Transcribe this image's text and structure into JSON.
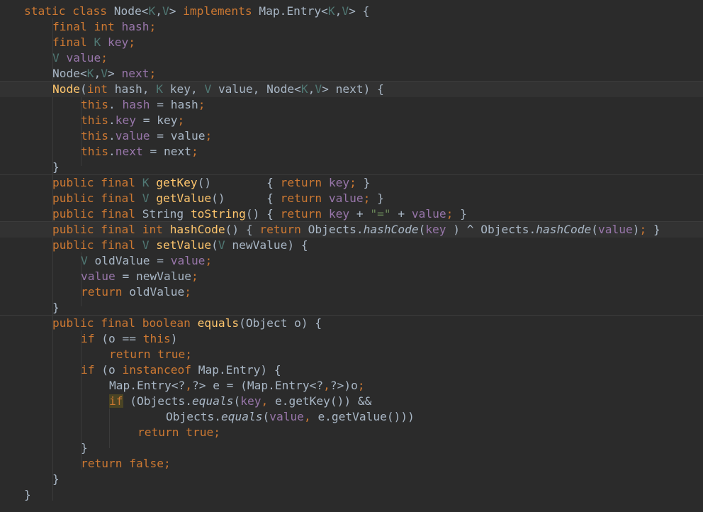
{
  "editor": {
    "language": "Java",
    "lines": [
      [
        [
          "kw",
          "static class "
        ],
        [
          "",
          "Node<"
        ],
        [
          "tp",
          "K"
        ],
        [
          "",
          ","
        ],
        [
          "tp",
          "V"
        ],
        [
          "",
          "> "
        ],
        [
          "kw",
          "implements "
        ],
        [
          "",
          "Map.Entry<"
        ],
        [
          "tp",
          "K"
        ],
        [
          "",
          ","
        ],
        [
          "tp",
          "V"
        ],
        [
          "",
          "> {"
        ]
      ],
      [
        [
          "kw",
          "final int "
        ],
        [
          "fd",
          "hash"
        ],
        [
          "kw",
          ";"
        ]
      ],
      [
        [
          "kw",
          "final "
        ],
        [
          "tp",
          "K "
        ],
        [
          "fd",
          "key"
        ],
        [
          "kw",
          ";"
        ]
      ],
      [
        [
          "tp",
          "V "
        ],
        [
          "fd",
          "value"
        ],
        [
          "kw",
          ";"
        ]
      ],
      [
        [
          "",
          "Node<"
        ],
        [
          "tp",
          "K"
        ],
        [
          "",
          ","
        ],
        [
          "tp",
          "V"
        ],
        [
          "",
          "> "
        ],
        [
          "fd",
          "next"
        ],
        [
          "kw",
          ";"
        ]
      ],
      [
        [
          "fn",
          "Node"
        ],
        [
          "",
          "("
        ],
        [
          "kw",
          "int "
        ],
        [
          "",
          "hash, "
        ],
        [
          "tp",
          "K "
        ],
        [
          "",
          "key, "
        ],
        [
          "tp",
          "V "
        ],
        [
          "",
          "value, Node<"
        ],
        [
          "tp",
          "K"
        ],
        [
          "",
          ","
        ],
        [
          "tp",
          "V"
        ],
        [
          "",
          "> next) {"
        ]
      ],
      [
        [
          "kw",
          "this"
        ],
        [
          "",
          ". "
        ],
        [
          "fd",
          "hash"
        ],
        [
          "",
          " = hash"
        ],
        [
          "kw",
          ";"
        ]
      ],
      [
        [
          "kw",
          "this"
        ],
        [
          "",
          "."
        ],
        [
          "fd",
          "key"
        ],
        [
          "",
          " = key"
        ],
        [
          "kw",
          ";"
        ]
      ],
      [
        [
          "kw",
          "this"
        ],
        [
          "",
          "."
        ],
        [
          "fd",
          "value"
        ],
        [
          "",
          " = value"
        ],
        [
          "kw",
          ";"
        ]
      ],
      [
        [
          "kw",
          "this"
        ],
        [
          "",
          "."
        ],
        [
          "fd",
          "next"
        ],
        [
          "",
          " = next"
        ],
        [
          "kw",
          ";"
        ]
      ],
      [
        [
          "",
          "}"
        ]
      ],
      [
        [
          "kw",
          "public final "
        ],
        [
          "tp",
          "K "
        ],
        [
          "fn",
          "getKey"
        ],
        [
          "",
          "()        { "
        ],
        [
          "kw",
          "return "
        ],
        [
          "fd",
          "key"
        ],
        [
          "kw",
          "; "
        ],
        [
          "",
          "}"
        ]
      ],
      [
        [
          "kw",
          "public final "
        ],
        [
          "tp",
          "V "
        ],
        [
          "fn",
          "getValue"
        ],
        [
          "",
          "()      { "
        ],
        [
          "kw",
          "return "
        ],
        [
          "fd",
          "value"
        ],
        [
          "kw",
          "; "
        ],
        [
          "",
          "}"
        ]
      ],
      [
        [
          "kw",
          "public final "
        ],
        [
          "",
          "String "
        ],
        [
          "fn",
          "toString"
        ],
        [
          "",
          "() { "
        ],
        [
          "kw",
          "return "
        ],
        [
          "fd",
          "key"
        ],
        [
          "",
          " + "
        ],
        [
          "st",
          "\"=\""
        ],
        [
          "",
          " + "
        ],
        [
          "fd",
          "value"
        ],
        [
          "kw",
          "; "
        ],
        [
          "",
          "}"
        ]
      ],
      [
        [
          "kw",
          "public final int "
        ],
        [
          "fn",
          "hashCode"
        ],
        [
          "",
          "() { "
        ],
        [
          "kw",
          "return "
        ],
        [
          "",
          "Objects."
        ],
        [
          "it",
          "hashCode"
        ],
        [
          "",
          "("
        ],
        [
          "fd",
          "key"
        ],
        [
          "",
          " ) ^ Objects."
        ],
        [
          "it",
          "hashCode"
        ],
        [
          "",
          "("
        ],
        [
          "fd",
          "value"
        ],
        [
          "",
          ")"
        ],
        [
          "kw",
          "; "
        ],
        [
          "",
          "}"
        ]
      ],
      [
        [
          "kw",
          "public final "
        ],
        [
          "tp",
          "V "
        ],
        [
          "fn",
          "setValue"
        ],
        [
          "",
          "("
        ],
        [
          "tp",
          "V "
        ],
        [
          "",
          "newValue) {"
        ]
      ],
      [
        [
          "tp",
          "V "
        ],
        [
          "",
          "oldValue = "
        ],
        [
          "fd",
          "value"
        ],
        [
          "kw",
          ";"
        ]
      ],
      [
        [
          "fd",
          "value"
        ],
        [
          "",
          " = newValue"
        ],
        [
          "kw",
          ";"
        ]
      ],
      [
        [
          "kw",
          "return "
        ],
        [
          "",
          "oldValue"
        ],
        [
          "kw",
          ";"
        ]
      ],
      [
        [
          "",
          "}"
        ]
      ],
      [
        [
          "kw",
          "public final boolean "
        ],
        [
          "fn",
          "equals"
        ],
        [
          "",
          "(Object o) {"
        ]
      ],
      [
        [
          "kw",
          "if "
        ],
        [
          "",
          "(o == "
        ],
        [
          "kw",
          "this"
        ],
        [
          "",
          ")"
        ]
      ],
      [
        [
          "kw",
          "return true"
        ],
        [
          "kw",
          ";"
        ]
      ],
      [
        [
          "kw",
          "if "
        ],
        [
          "",
          "(o "
        ],
        [
          "kw",
          "instanceof "
        ],
        [
          "",
          "Map.Entry) {"
        ]
      ],
      [
        [
          "",
          "Map.Entry<?"
        ],
        [
          "kw",
          ","
        ],
        [
          "",
          "?> e = (Map.Entry<?"
        ],
        [
          "kw",
          ","
        ],
        [
          "",
          "?>)o"
        ],
        [
          "kw",
          ";"
        ]
      ],
      [
        [
          "kw",
          "if"
        ],
        [
          "",
          " (Objects."
        ],
        [
          "it",
          "equals"
        ],
        [
          "",
          "("
        ],
        [
          "fd",
          "key"
        ],
        [
          "kw",
          ", "
        ],
        [
          "",
          "e.getKey()) &&"
        ]
      ],
      [
        [
          "",
          "Objects."
        ],
        [
          "it",
          "equals"
        ],
        [
          "",
          "("
        ],
        [
          "fd",
          "value"
        ],
        [
          "kw",
          ", "
        ],
        [
          "",
          "e.getValue()))"
        ]
      ],
      [
        [
          "kw",
          "return true"
        ],
        [
          "kw",
          ";"
        ]
      ],
      [
        [
          "",
          "}"
        ]
      ],
      [
        [
          "kw",
          "return false"
        ],
        [
          "kw",
          ";"
        ]
      ],
      [
        [
          "",
          "}"
        ]
      ],
      [
        [
          "",
          "}"
        ]
      ]
    ]
  }
}
